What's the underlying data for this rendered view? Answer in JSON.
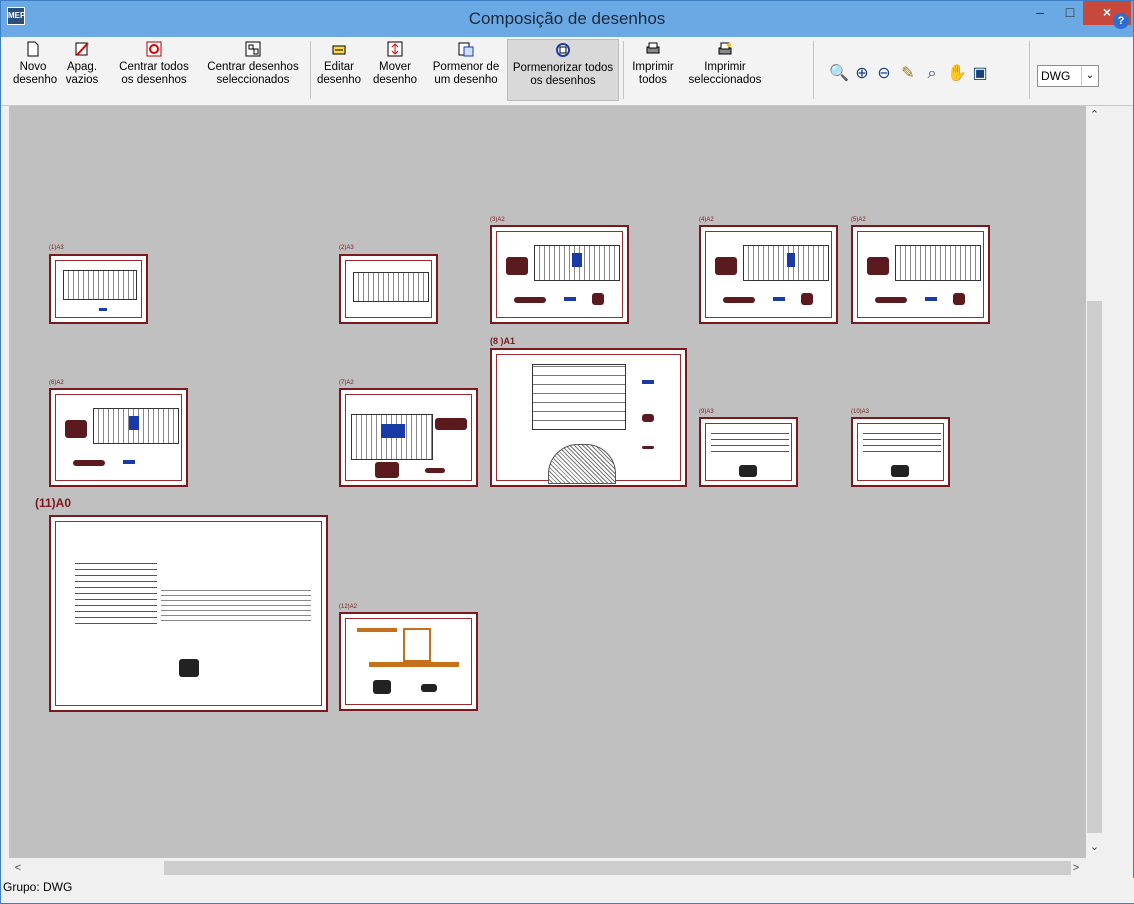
{
  "window": {
    "title": "Composição de desenhos",
    "app_icon": "MEP",
    "controls": {
      "minimize": "–",
      "maximize": "□",
      "close": "×"
    }
  },
  "toolbar": [
    {
      "id": "novo",
      "label": "Novo desenho",
      "icon": "new-document-icon",
      "glyph": "🗋"
    },
    {
      "id": "apag",
      "label": "Apag. vazios",
      "icon": "erase-empty-icon",
      "glyph": "✎"
    },
    {
      "id": "centrar_todos",
      "label": "Centrar todos os desenhos",
      "icon": "center-all-icon",
      "glyph": "⊕"
    },
    {
      "id": "centrar_sel",
      "label": "Centrar desenhos seleccionados",
      "icon": "center-selected-icon",
      "glyph": "⊞"
    },
    {
      "id": "editar",
      "label": "Editar desenho",
      "icon": "edit-drawing-icon",
      "glyph": "✐"
    },
    {
      "id": "mover",
      "label": "Mover desenho",
      "icon": "move-drawing-icon",
      "glyph": "⇅"
    },
    {
      "id": "pormenor",
      "label": "Pormenor de um desenho",
      "icon": "detail-drawing-icon",
      "glyph": "⧉"
    },
    {
      "id": "pormenorizar",
      "label": "Pormenorizar todos os desenhos",
      "icon": "detail-all-icon",
      "glyph": "◎"
    },
    {
      "id": "imprimir_todos",
      "label": "Imprimir todos",
      "icon": "print-all-icon",
      "glyph": "⎙"
    },
    {
      "id": "imprimir_sel",
      "label": "Imprimir seleccionados",
      "icon": "print-selected-icon",
      "glyph": "⎙"
    }
  ],
  "view_tools": [
    "zoom-window-icon",
    "zoom-in-icon",
    "zoom-out-icon",
    "pencil-icon",
    "zoom-previous-icon",
    "pan-hand-icon",
    "redraw-icon"
  ],
  "group_select": {
    "value": "DWG"
  },
  "status": {
    "text": "Grupo: DWG"
  },
  "sheets": [
    {
      "label": "(1)A3"
    },
    {
      "label": "(2)A3"
    },
    {
      "label": "(3)A2"
    },
    {
      "label": "(4)A2"
    },
    {
      "label": "(5)A2"
    },
    {
      "label": "(6)A2"
    },
    {
      "label": "(7)A2"
    },
    {
      "label": "(8 )A1"
    },
    {
      "label": "(9)A3"
    },
    {
      "label": "(10)A3"
    },
    {
      "label": "(11)A0"
    },
    {
      "label": "(12)A2"
    }
  ],
  "colors": {
    "titlebar": "#6aa9e4",
    "sheet_border": "#7a1a1f",
    "canvas": "#c0c0c0",
    "close": "#c9483c"
  }
}
